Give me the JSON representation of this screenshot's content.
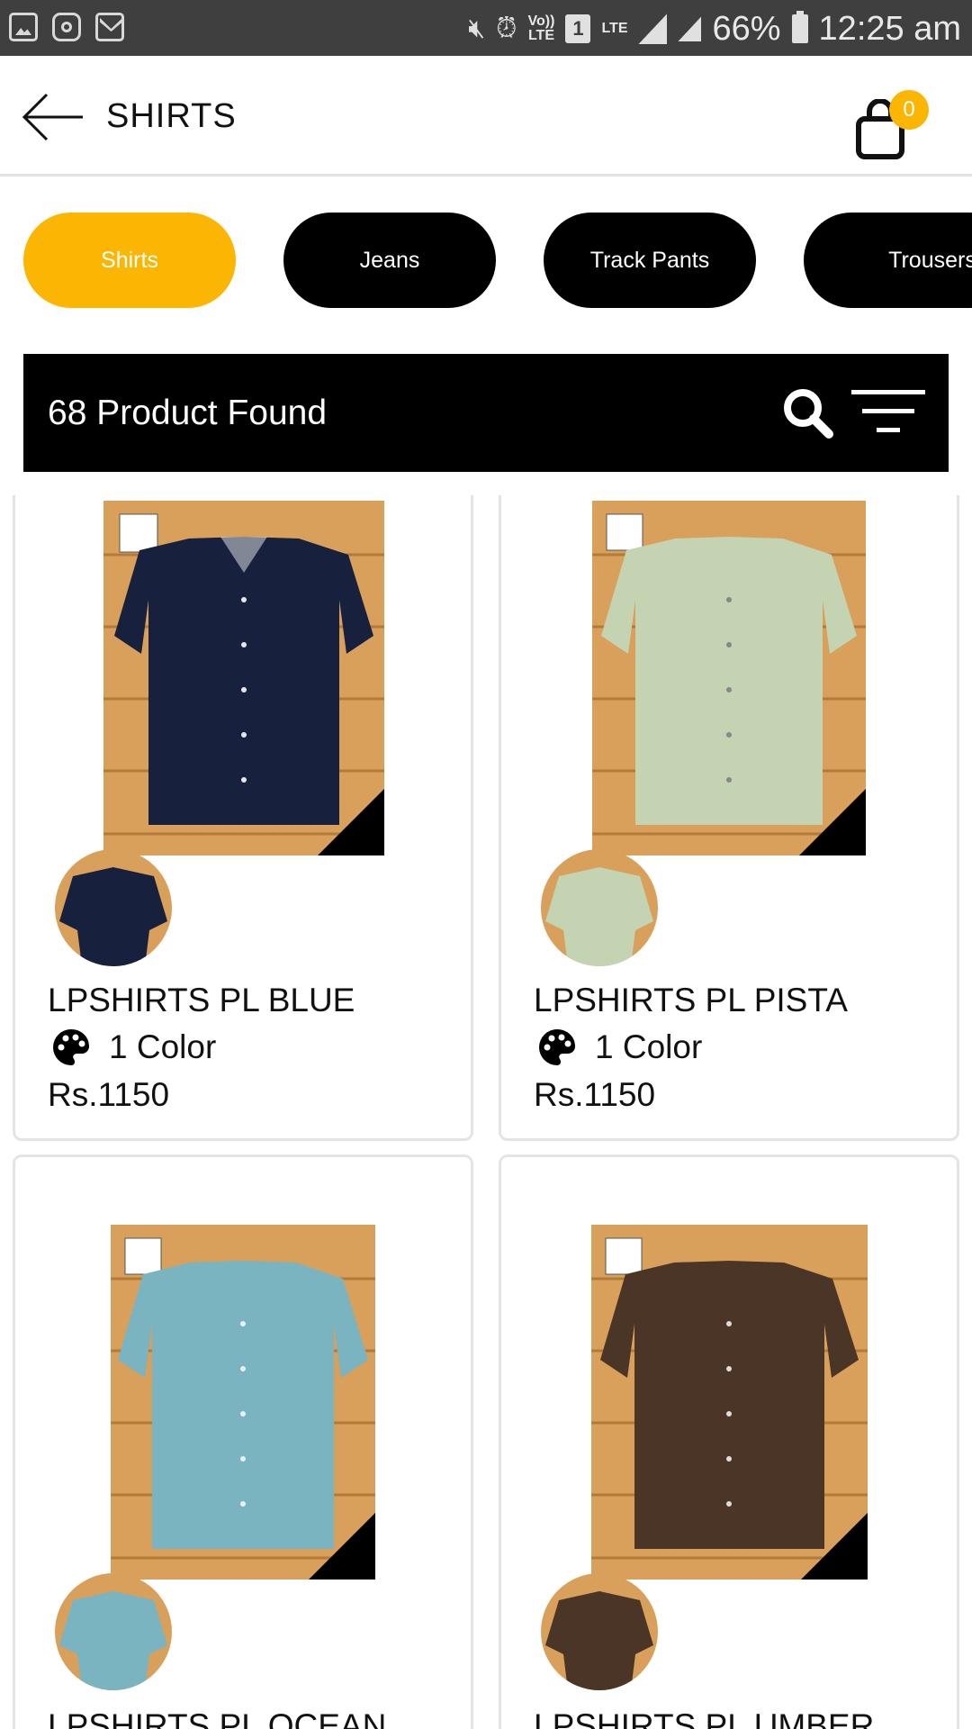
{
  "status_bar": {
    "lte_top": "Vo))",
    "lte_bottom": "LTE",
    "sim": "1",
    "lte": "LTE",
    "battery": "66%",
    "time": "12:25 am"
  },
  "header": {
    "title": "SHIRTS",
    "cart_count": "0"
  },
  "categories": [
    "Shirts",
    "Jeans",
    "Track Pants",
    "Trousers"
  ],
  "active_category": "Shirts",
  "results": {
    "text": "68 Product Found"
  },
  "products": [
    {
      "name": "LPSHIRTS PL BLUE",
      "colors": "1 Color",
      "price": "Rs.1150",
      "color_hex": "#17203d",
      "tag": "BLUE"
    },
    {
      "name": "LPSHIRTS PL PISTA",
      "colors": "1 Color",
      "price": "Rs.1150",
      "color_hex": "#c4d3b2",
      "tag": "PISTA"
    },
    {
      "name": "LPSHIRTS PL OCEAN",
      "colors": "",
      "price": "",
      "color_hex": "#79b4c0",
      "tag": "OCEAN"
    },
    {
      "name": "LPSHIRTS PL UMBER",
      "colors": "",
      "price": "",
      "color_hex": "#4a3526",
      "tag": "UMBER"
    }
  ],
  "colors": {
    "accent": "#fbb503",
    "pill_dark": "#000000",
    "status_bar": "#3f3f3f"
  }
}
